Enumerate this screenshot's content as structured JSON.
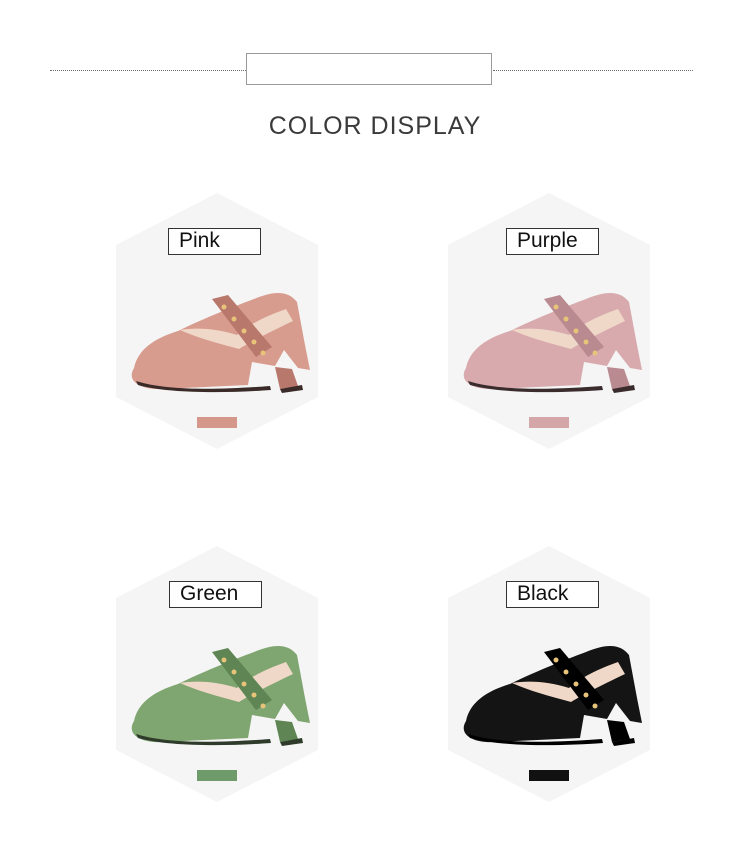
{
  "header": {
    "title": "COLOR DISPLAY"
  },
  "products": [
    {
      "id": "pink",
      "label": "Pink",
      "swatch": "#d4978a",
      "body": "#d89c8f",
      "shade": "#b9786c",
      "sole": "#3a2b28"
    },
    {
      "id": "purple",
      "label": "Purple",
      "swatch": "#d5a6a8",
      "body": "#d8aaae",
      "shade": "#b98b90",
      "sole": "#3a2b2d"
    },
    {
      "id": "green",
      "label": "Green",
      "swatch": "#6f9a6a",
      "body": "#7fa670",
      "shade": "#5e8553",
      "sole": "#2e3a2a"
    },
    {
      "id": "black",
      "label": "Black",
      "swatch": "#111111",
      "body": "#141414",
      "shade": "#000000",
      "sole": "#000000"
    }
  ]
}
